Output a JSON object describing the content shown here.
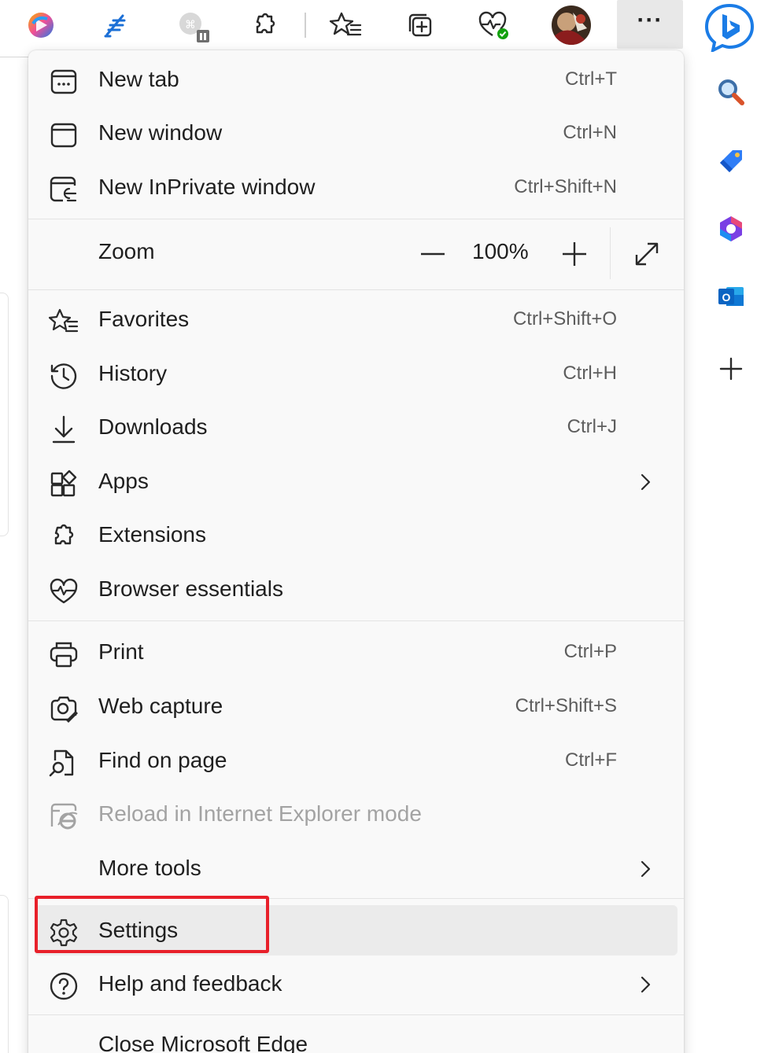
{
  "toolbar": {
    "icons": [
      "copilot-icon",
      "pen-feather-icon",
      "extension-paused-icon",
      "extensions-puzzle-icon",
      "favorites-icon",
      "collections-icon",
      "browser-essentials-icon",
      "profile-avatar",
      "more-options-icon"
    ],
    "more_label": "···"
  },
  "menu": {
    "new_tab": {
      "label": "New tab",
      "shortcut": "Ctrl+T"
    },
    "new_window": {
      "label": "New window",
      "shortcut": "Ctrl+N"
    },
    "new_inprivate": {
      "label": "New InPrivate window",
      "shortcut": "Ctrl+Shift+N"
    },
    "zoom": {
      "label": "Zoom",
      "value": "100%"
    },
    "favorites": {
      "label": "Favorites",
      "shortcut": "Ctrl+Shift+O"
    },
    "history": {
      "label": "History",
      "shortcut": "Ctrl+H"
    },
    "downloads": {
      "label": "Downloads",
      "shortcut": "Ctrl+J"
    },
    "apps": {
      "label": "Apps"
    },
    "extensions": {
      "label": "Extensions"
    },
    "browser_essentials": {
      "label": "Browser essentials"
    },
    "print": {
      "label": "Print",
      "shortcut": "Ctrl+P"
    },
    "web_capture": {
      "label": "Web capture",
      "shortcut": "Ctrl+Shift+S"
    },
    "find_on_page": {
      "label": "Find on page",
      "shortcut": "Ctrl+F"
    },
    "reload_ie": {
      "label": "Reload in Internet Explorer mode"
    },
    "more_tools": {
      "label": "More tools"
    },
    "settings": {
      "label": "Settings"
    },
    "help": {
      "label": "Help and feedback"
    },
    "close": {
      "label": "Close Microsoft Edge"
    }
  },
  "sidebar": {
    "icons": [
      "bing-chat-icon",
      "search-icon",
      "shopping-tag-icon",
      "microsoft-365-icon",
      "outlook-icon",
      "add-icon"
    ]
  },
  "colors": {
    "highlight_box": "#e8202a",
    "menu_bg": "#f9f9f9",
    "hover_bg": "#ebebeb",
    "bing_blue": "#1b7ce6"
  }
}
